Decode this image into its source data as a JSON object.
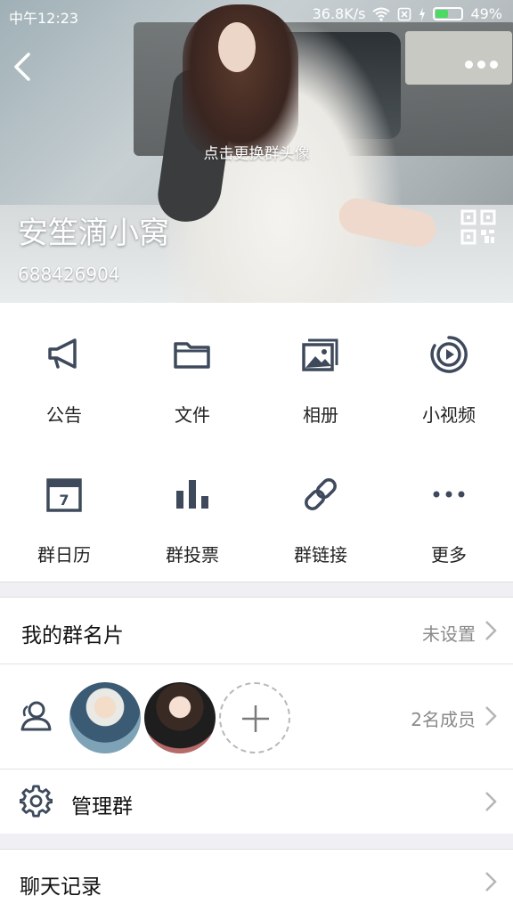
{
  "status_bar": {
    "time": "中午12:23",
    "speed": "36.8K/s",
    "battery": "49%",
    "battery_level": 0.49
  },
  "header": {
    "change_avatar_hint": "点击更换群头像",
    "group_name": "安笙滴小窝",
    "group_id": "688426904"
  },
  "features": [
    {
      "label": "公告",
      "icon": "megaphone-icon"
    },
    {
      "label": "文件",
      "icon": "folder-icon"
    },
    {
      "label": "相册",
      "icon": "photo-album-icon"
    },
    {
      "label": "小视频",
      "icon": "video-play-icon"
    },
    {
      "label": "群日历",
      "icon": "calendar-icon"
    },
    {
      "label": "群投票",
      "icon": "bar-chart-icon"
    },
    {
      "label": "群链接",
      "icon": "link-icon"
    },
    {
      "label": "更多",
      "icon": "more-dots-icon"
    }
  ],
  "calendar_day": "7",
  "my_card": {
    "title": "我的群名片",
    "value": "未设置"
  },
  "members": {
    "count_text": "2名成员"
  },
  "manage": {
    "title": "管理群"
  },
  "chat_history": {
    "title": "聊天记录"
  },
  "colors": {
    "icon": "#3e4a5c",
    "accent_green": "#4cd964"
  }
}
